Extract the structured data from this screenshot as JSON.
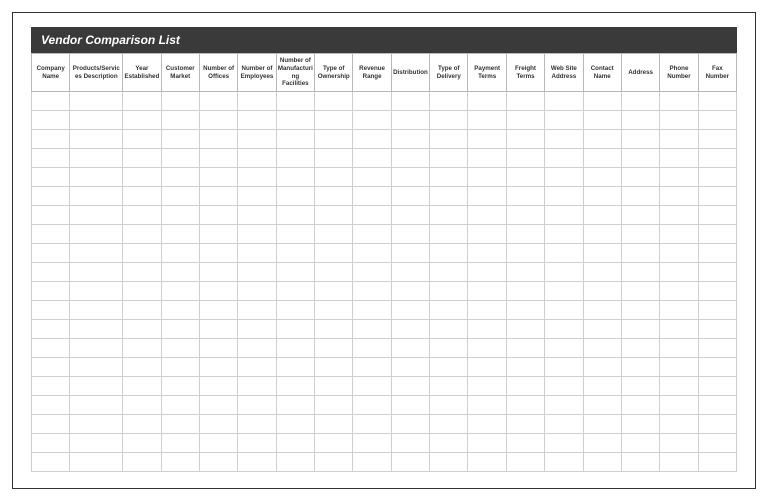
{
  "title": "Vendor Comparison List",
  "columns": [
    "Company Name",
    "Products/Services Description",
    "Year Established",
    "Customer Market",
    "Number of Offices",
    "Number of Employees",
    "Number of Manufacturing Facilities",
    "Type of Ownership",
    "Revenue Range",
    "Distribution",
    "Type of Delivery",
    "Payment Terms",
    "Freight Terms",
    "Web Site Address",
    "Contact Name",
    "Address",
    "Phone Number",
    "Fax Number"
  ],
  "rowCount": 20
}
